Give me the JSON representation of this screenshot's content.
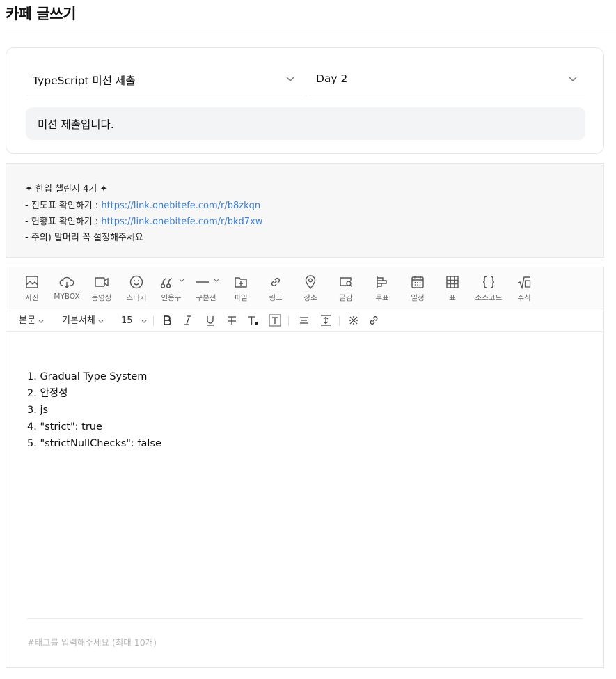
{
  "page": {
    "title": "카페 글쓰기"
  },
  "form": {
    "board_select": {
      "value": "TypeScript 미션 제출"
    },
    "head_select": {
      "value": "Day 2"
    },
    "title_input": {
      "value": "미션 제출입니다."
    }
  },
  "notice": {
    "line1": "✦ 한입 챌린지 4기 ✦",
    "line2_label": "- 진도표 확인하기 : ",
    "line2_link": "https://link.onebitefe.com/r/b8zkqn",
    "line3_label": "- 현황표 확인하기 : ",
    "line3_link": "https://link.onebitefe.com/r/bkd7xw",
    "line4": "- 주의) 말머리 꼭 설정해주세요"
  },
  "toolbar": {
    "items": [
      {
        "label": "사진",
        "icon": "image-icon"
      },
      {
        "label": "MYBOX",
        "icon": "cloud-icon"
      },
      {
        "label": "동영상",
        "icon": "video-icon"
      },
      {
        "label": "스티커",
        "icon": "smile-icon"
      },
      {
        "label": "인용구",
        "icon": "quote-icon"
      },
      {
        "label": "구분선",
        "icon": "divider-icon"
      },
      {
        "label": "파일",
        "icon": "folder-plus-icon"
      },
      {
        "label": "링크",
        "icon": "link-icon"
      },
      {
        "label": "장소",
        "icon": "map-pin-icon"
      },
      {
        "label": "글감",
        "icon": "search-card-icon"
      },
      {
        "label": "투표",
        "icon": "poll-icon"
      },
      {
        "label": "일정",
        "icon": "calendar-icon"
      },
      {
        "label": "표",
        "icon": "table-icon"
      },
      {
        "label": "소스코드",
        "icon": "braces-icon"
      },
      {
        "label": "수식",
        "icon": "sqrt-icon"
      }
    ]
  },
  "format_bar": {
    "paragraph": "본문",
    "font": "기본서체",
    "size": "15"
  },
  "editor": {
    "lines": [
      "1. Gradual Type System",
      "2. 안정성",
      "3. js",
      "4. \"strict\": true",
      "5. \"strictNullChecks\": false"
    ],
    "tag_placeholder": "#태그를 입력해주세요 (최대 10개)"
  },
  "colors": {
    "link": "#3a7fd5",
    "icon": "#555555",
    "notice_bg": "#f7f7f7",
    "input_bg": "#f3f4f6"
  }
}
